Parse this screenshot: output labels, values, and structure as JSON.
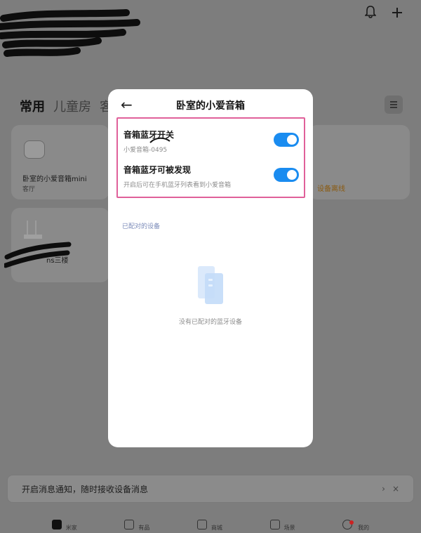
{
  "background": {
    "header": {
      "blurred_title_1": "",
      "blurred_title_2": ""
    },
    "top_actions": {
      "bell_icon": "bell-icon",
      "add_icon": "plus-icon"
    },
    "room_tabs": [
      {
        "label": "常用"
      },
      {
        "label": "儿童房"
      },
      {
        "label": "客"
      }
    ],
    "devices": [
      {
        "name": "卧室的小爱音箱mini",
        "room": "客厅"
      },
      {
        "name": "ns三楼",
        "room": ""
      },
      {
        "name": "",
        "status": "设备离线"
      }
    ],
    "notify_bar": {
      "text": "开启消息通知，随时接收设备消息",
      "chevron": "›",
      "close": "×"
    },
    "bottom_nav": [
      {
        "label": "米家"
      },
      {
        "label": "有品"
      },
      {
        "label": "商城"
      },
      {
        "label": "场景"
      },
      {
        "label": "我的"
      }
    ]
  },
  "modal": {
    "title": "卧室的小爱音箱",
    "back_icon": "←",
    "settings": [
      {
        "label": "音箱蓝牙开关",
        "sub": "小爱音箱-0495",
        "toggle_on": true
      },
      {
        "label": "音箱蓝牙可被发现",
        "sub": "开启后可在手机蓝牙列表看到小爱音箱",
        "toggle_on": true
      }
    ],
    "paired_section_title": "已配对的设备",
    "empty_text": "没有已配对的蓝牙设备"
  },
  "colors": {
    "toggle_on": "#1a8cf0",
    "highlight": "#e0609a",
    "section_title": "#7a8ab8"
  }
}
